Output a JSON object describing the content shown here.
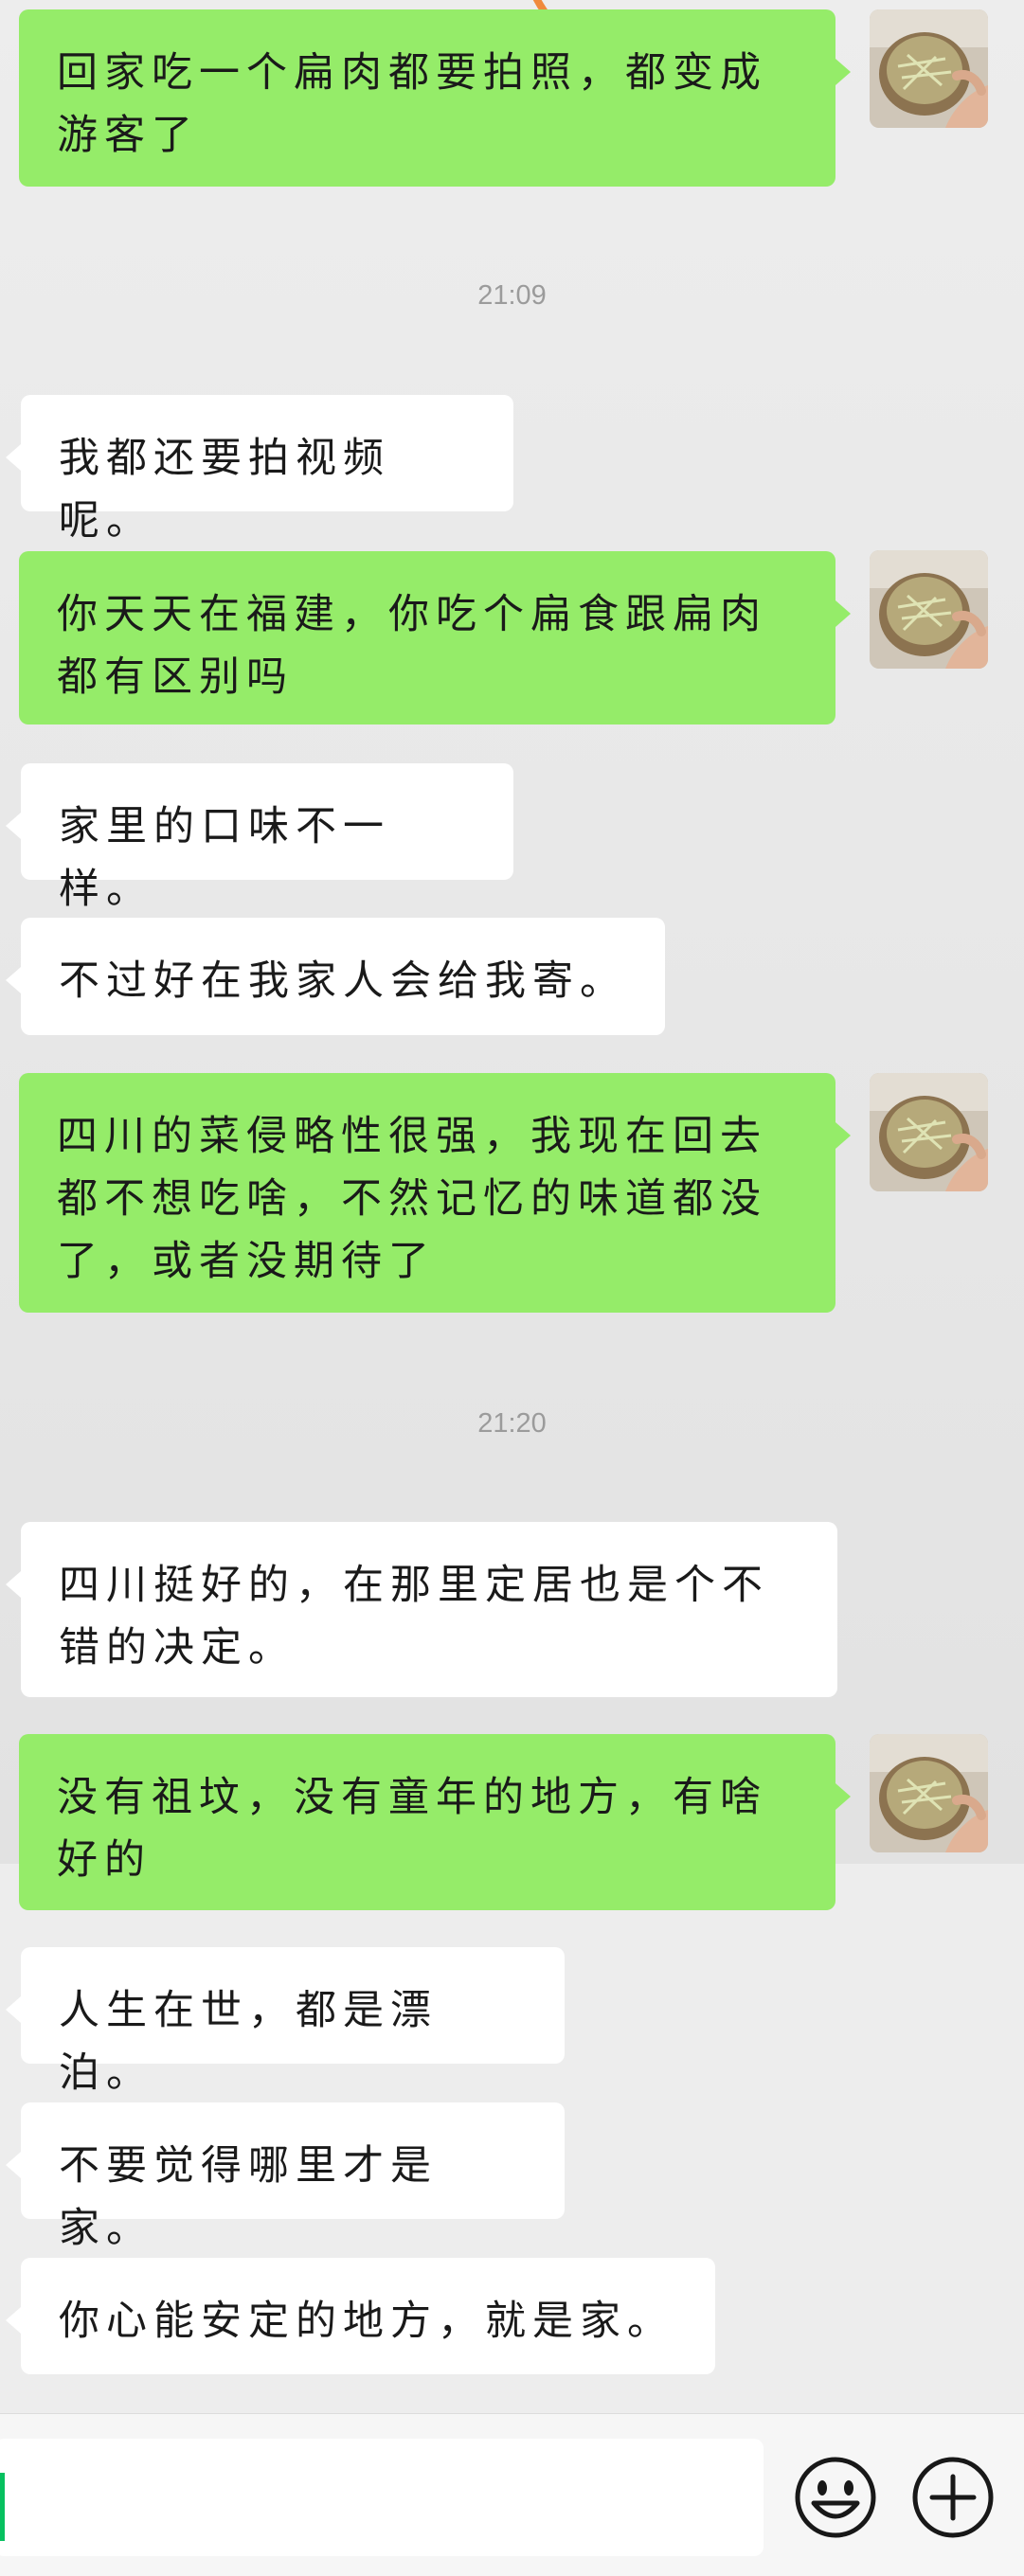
{
  "messages": [
    {
      "side": "sent",
      "text": "回家吃一个扁肉都要拍照，都变成游客了"
    },
    {
      "time": "21:09"
    },
    {
      "side": "recv",
      "text": "我都还要拍视频呢。"
    },
    {
      "side": "sent",
      "text": "你天天在福建，你吃个扁食跟扁肉都有区别吗"
    },
    {
      "side": "recv",
      "text": "家里的口味不一样。"
    },
    {
      "side": "recv",
      "text": "不过好在我家人会给我寄。"
    },
    {
      "side": "sent",
      "text": "四川的菜侵略性很强，我现在回去都不想吃啥，不然记忆的味道都没了，或者没期待了"
    },
    {
      "time": "21:20"
    },
    {
      "side": "recv",
      "text": "四川挺好的，在那里定居也是个不错的决定。"
    },
    {
      "side": "sent",
      "text": "没有祖坟，没有童年的地方，有啥好的"
    },
    {
      "side": "recv",
      "text": "人生在世，都是漂泊。"
    },
    {
      "side": "recv",
      "text": "不要觉得哪里才是家。"
    },
    {
      "side": "recv",
      "text": "你心能安定的地方，就是家。"
    }
  ],
  "input_bar": {
    "value": "",
    "emoji_icon": "smiley-face-icon",
    "plus_icon": "plus-circle-icon"
  },
  "colors": {
    "sent_bubble": "#95EC69",
    "recv_bubble": "#FFFFFF",
    "background": "#EDEDED",
    "timestamp": "#9B9B9B",
    "cursor": "#07C160"
  }
}
